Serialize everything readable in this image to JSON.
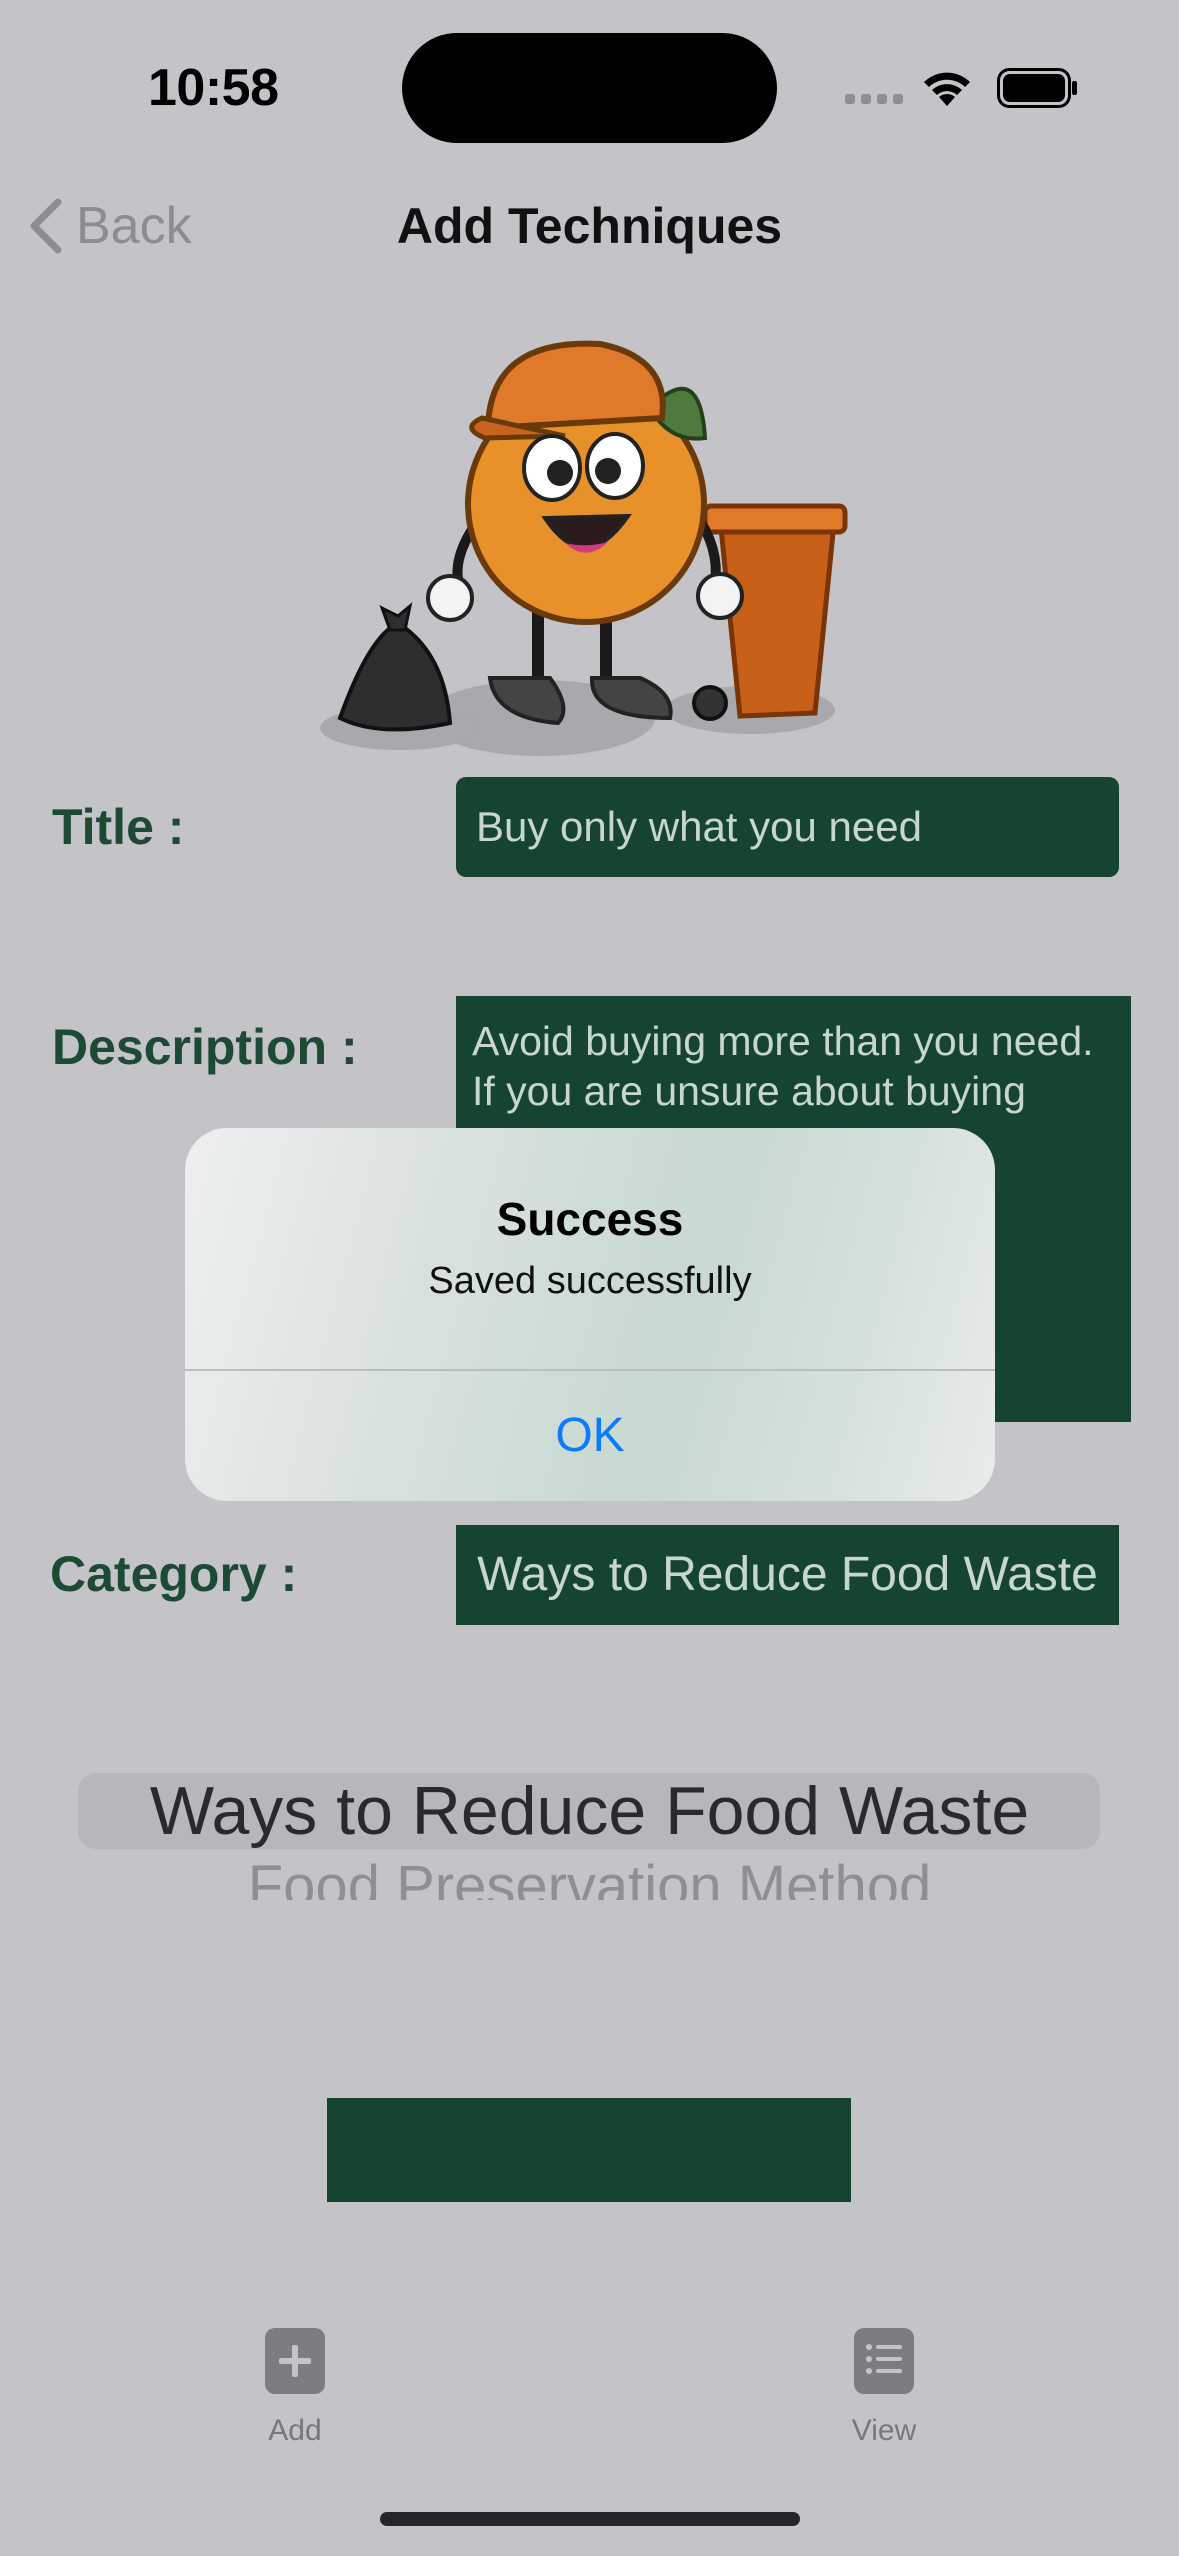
{
  "status_bar": {
    "time": "10:58"
  },
  "nav": {
    "back_label": "Back",
    "title": "Add Techniques"
  },
  "form": {
    "title_label": "Title :",
    "title_value": "Buy only what you need",
    "description_label": "Description :",
    "description_value": "Avoid buying more than you need. If you are unsure about buying",
    "category_label": "Category :",
    "category_value": "Ways to Reduce Food Waste"
  },
  "picker": {
    "selected": "Ways to Reduce Food Waste",
    "next": "Food Preservation Method"
  },
  "tab_bar": [
    {
      "label": "Add",
      "icon": "plus-square-icon"
    },
    {
      "label": "View",
      "icon": "list-doc-icon"
    }
  ],
  "alert": {
    "title": "Success",
    "message": "Saved successfully",
    "ok_label": "OK"
  },
  "colors": {
    "field_bg": "#154531",
    "label": "#1c4a35",
    "alert_button": "#0a7aff",
    "background": "#c4c3c8"
  }
}
